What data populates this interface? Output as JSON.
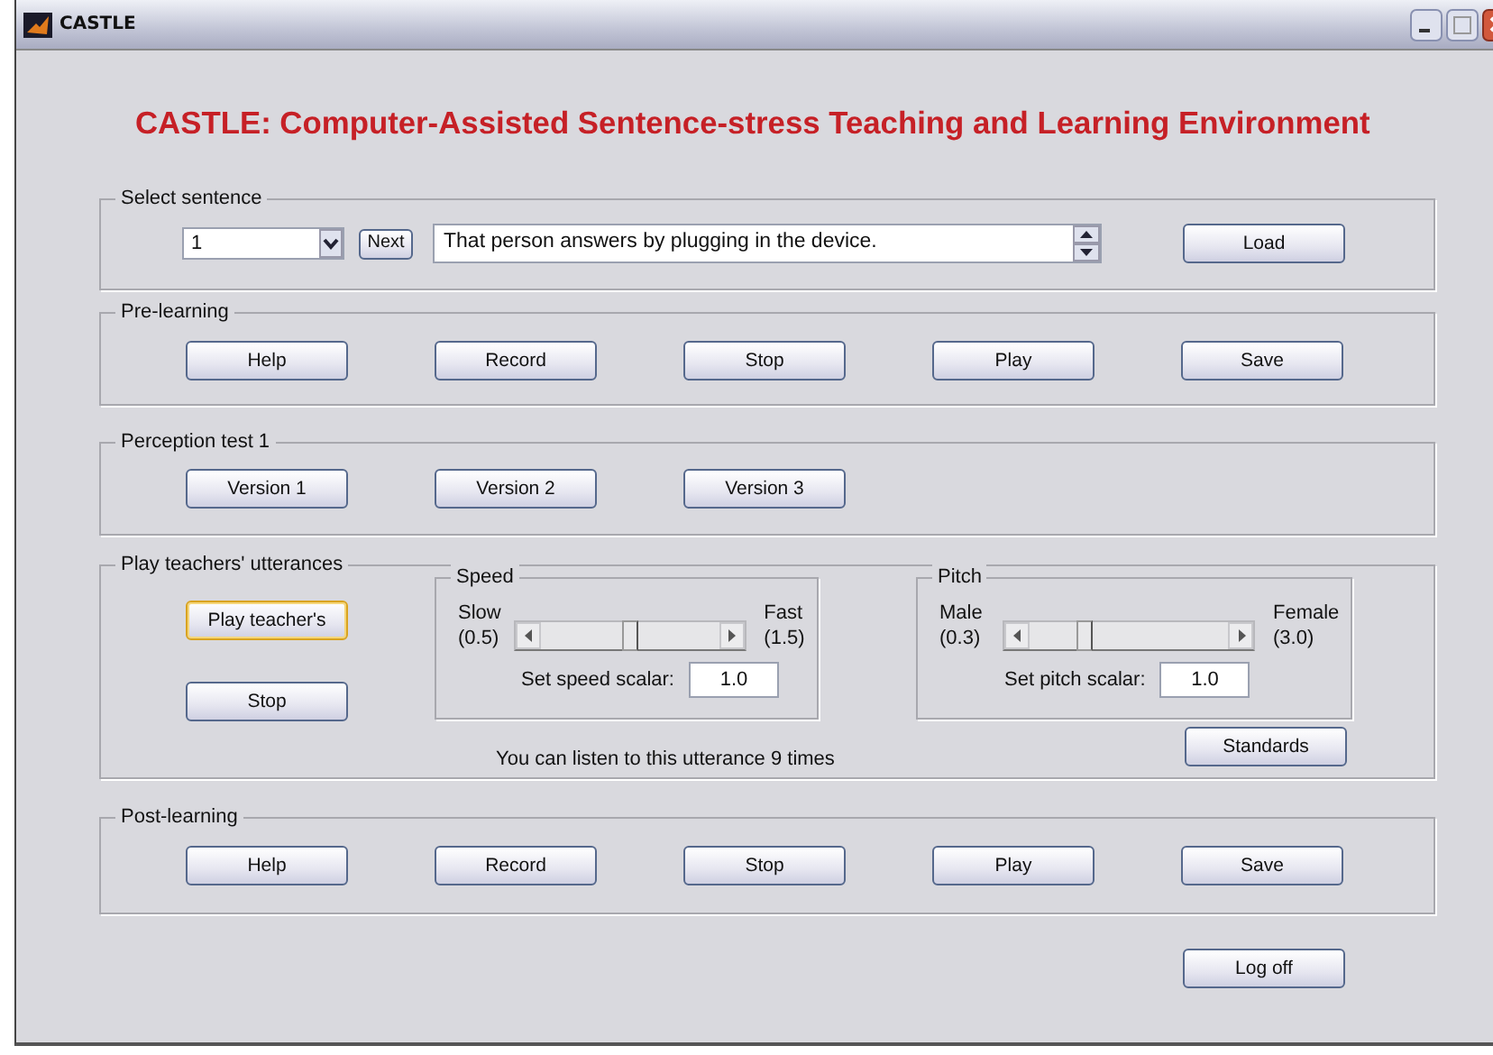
{
  "window": {
    "title": "CASTLE"
  },
  "heading": "CASTLE:  Computer-Assisted Sentence-stress Teaching and Learning Environment",
  "select_sentence": {
    "label": "Select sentence",
    "dropdown_value": "1",
    "next_button": "Next",
    "sentence": "That person answers by plugging in the device.",
    "load_button": "Load"
  },
  "pre_learning": {
    "label": "Pre-learning",
    "buttons": [
      "Help",
      "Record",
      "Stop",
      "Play",
      "Save"
    ]
  },
  "perception_test": {
    "label": "Perception test 1",
    "buttons": [
      "Version 1",
      "Version 2",
      "Version 3"
    ]
  },
  "play_teachers": {
    "label": "Play teachers' utterances",
    "play_button": "Play teacher's",
    "stop_button": "Stop",
    "speed": {
      "label": "Speed",
      "min_label": "Slow",
      "min_range": "(0.5)",
      "max_label": "Fast",
      "max_range": "(1.5)",
      "level": 0.5,
      "scalar_label": "Set speed scalar:",
      "scalar_value": "1.0"
    },
    "pitch": {
      "label": "Pitch",
      "min_label": "Male",
      "min_range": "(0.3)",
      "max_label": "Female",
      "max_range": "(3.0)",
      "level": 0.26,
      "scalar_label": "Set pitch scalar:",
      "scalar_value": "1.0"
    },
    "message": "You can listen to this utterance 9 times",
    "standards_button": "Standards"
  },
  "post_learning": {
    "label": "Post-learning",
    "buttons": [
      "Help",
      "Record",
      "Stop",
      "Play",
      "Save"
    ]
  },
  "log_off_button": "Log off"
}
